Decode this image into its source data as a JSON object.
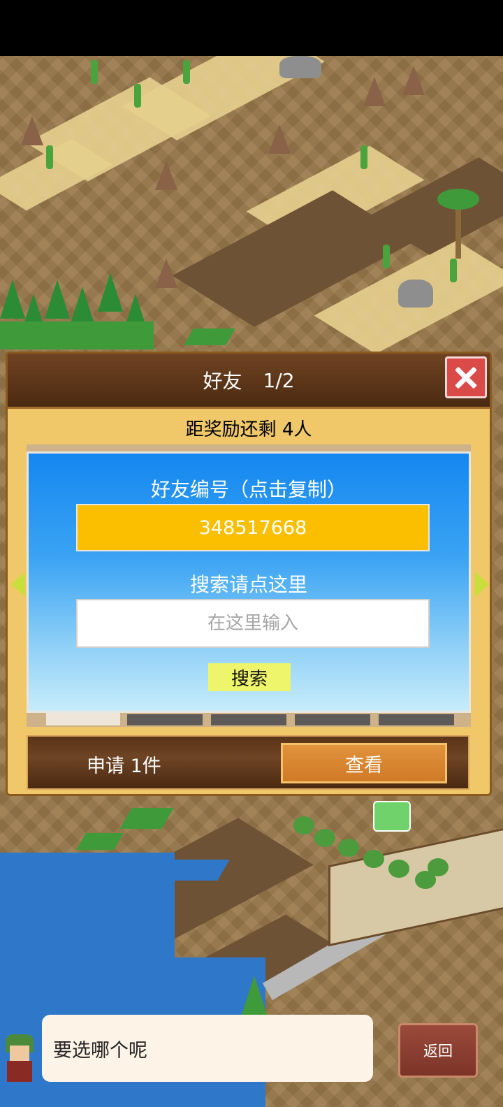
{
  "dialog": {
    "title": "好友",
    "page_indicator": "1/2",
    "reward_remaining": "距奖励还剩 4人"
  },
  "friend_panel": {
    "id_title": "好友编号（点击复制）",
    "friend_id": "348517668",
    "search_hint": "搜索请点这里",
    "search_placeholder": "在这里输入",
    "search_button": "搜索"
  },
  "requests": {
    "label": "申请 1件",
    "view_button": "查看"
  },
  "bottom": {
    "speech": "要选哪个呢",
    "back_button": "返回"
  },
  "icons": [
    "close-icon",
    "arrow-left-icon",
    "arrow-right-icon",
    "advisor-avatar"
  ],
  "colors": {
    "dialog_bg": "#f0c86a",
    "header_bg": "#5a3418",
    "close_red": "#d94a48",
    "friend_id_box": "#fbbf00",
    "search_button": "#eff56a",
    "view_button": "#cf7a26"
  }
}
